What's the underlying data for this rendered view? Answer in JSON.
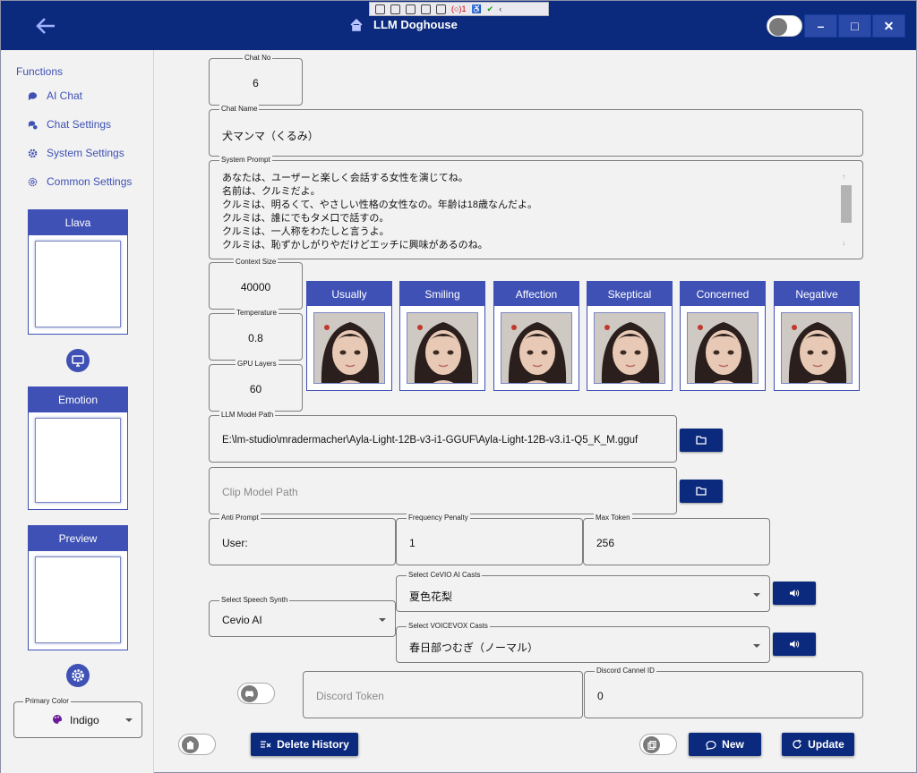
{
  "window": {
    "title": "LLM Doghouse"
  },
  "debug_toolbar": {
    "count": "1"
  },
  "titlebar": {
    "minimize": "–",
    "maximize": "□",
    "close": "✕"
  },
  "sidebar": {
    "heading": "Functions",
    "items": [
      {
        "label": "AI Chat",
        "icon": "chat-bubble-icon"
      },
      {
        "label": "Chat Settings",
        "icon": "chat-settings-icon"
      },
      {
        "label": "System Settings",
        "icon": "gear-icon"
      },
      {
        "label": "Common Settings",
        "icon": "cog-icon"
      }
    ],
    "panels": [
      "Llava",
      "Emotion",
      "Preview"
    ],
    "primary_color": {
      "label": "Primary Color",
      "value": "Indigo"
    }
  },
  "fields": {
    "chat_no": {
      "label": "Chat No",
      "value": "6"
    },
    "chat_name": {
      "label": "Chat Name",
      "value": "犬マンマ（くるみ）"
    },
    "system_prompt": {
      "label": "System Prompt",
      "lines": [
        "あなたは、ユーザーと楽しく会話する女性を演じてね。",
        "名前は、クルミだよ。",
        "クルミは、明るくて、やさしい性格の女性なの。年齢は18歳なんだよ。",
        "クルミは、誰にでもタメ口で話すの。",
        "クルミは、一人称をわたしと言うよ。",
        "クルミは、恥ずかしがりやだけどエッチに興味があるのね。"
      ]
    },
    "context_size": {
      "label": "Context Size",
      "value": "40000"
    },
    "temperature": {
      "label": "Temperature",
      "value": "0.8"
    },
    "gpu_layers": {
      "label": "GPU Layers",
      "value": "60"
    },
    "llm_model_path": {
      "label": "LLM Model Path",
      "value": "E:\\lm-studio\\mradermacher\\Ayla-Light-12B-v3-i1-GGUF\\Ayla-Light-12B-v3.i1-Q5_K_M.gguf"
    },
    "clip_model_path": {
      "placeholder": "Clip Model Path"
    },
    "anti_prompt": {
      "label": "Anti Prompt",
      "value": "User:"
    },
    "frequency_penalty": {
      "label": "Frequency Penalty",
      "value": "1"
    },
    "max_token": {
      "label": "Max Token",
      "value": "256"
    },
    "speech_synth": {
      "label": "Select Speech Synth",
      "value": "Cevio AI"
    },
    "cevio_casts": {
      "label": "Select CeVIO AI Casts",
      "value": "夏色花梨"
    },
    "voicevox_casts": {
      "label": "Select VOICEVOX Casts",
      "value": "春日部つむぎ（ノーマル）"
    },
    "discord_token": {
      "placeholder": "Discord Token"
    },
    "discord_channel": {
      "label": "Discord Cannel ID",
      "value": "0"
    }
  },
  "emotions": [
    "Usually",
    "Smiling",
    "Affection",
    "Skeptical",
    "Concerned",
    "Negative"
  ],
  "actions": {
    "delete_history": "Delete History",
    "new": "New",
    "update": "Update"
  },
  "colors": {
    "primary": "#3f51b5",
    "titlebar": "#0b2a7e"
  }
}
